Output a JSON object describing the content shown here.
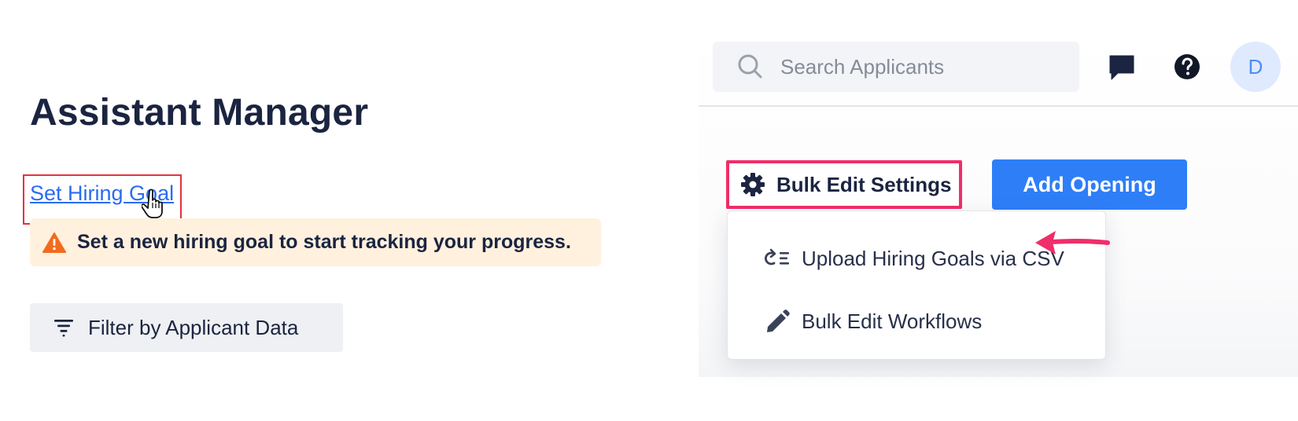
{
  "left_panel": {
    "title": "Assistant Manager",
    "set_goal_link": "Set Hiring Goal",
    "alert": {
      "icon": "warning-icon",
      "text": "Set a new hiring goal to start tracking your progress."
    },
    "filter_button": {
      "icon": "filter-icon",
      "label": "Filter by Applicant Data"
    }
  },
  "right_panel": {
    "search": {
      "icon": "search-icon",
      "placeholder": "Search Applicants",
      "value": ""
    },
    "header_icons": [
      "chat-icon",
      "help-icon"
    ],
    "avatar_initial": "D",
    "bulk_edit_button": {
      "icon": "gear-icon",
      "label": "Bulk Edit Settings"
    },
    "add_opening_button": {
      "label": "Add Opening"
    },
    "dropdown_items": [
      {
        "icon": "upload-list-icon",
        "label": "Upload Hiring Goals via CSV"
      },
      {
        "icon": "pencil-icon",
        "label": "Bulk Edit Workflows"
      }
    ]
  },
  "colors": {
    "title_text": "#1b2440",
    "link": "#2a6cf0",
    "highlight_box": "#e2333d",
    "alert_bg": "#fff1de",
    "warning": "#f26b1d",
    "primary_button": "#2e7ef7",
    "annotation_pink": "#ef2e6a",
    "avatar_bg": "#dfeaff"
  }
}
